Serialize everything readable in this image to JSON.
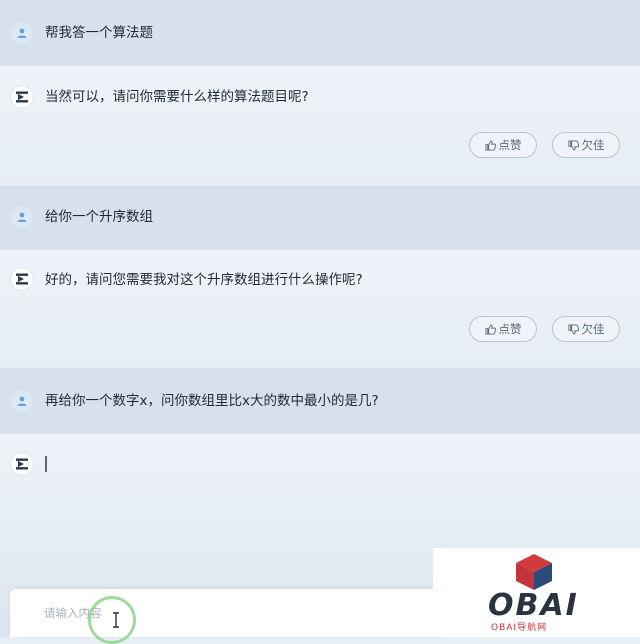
{
  "messages": [
    {
      "role": "user",
      "text": "帮我答一个算法题"
    },
    {
      "role": "bot",
      "text": "当然可以，请问你需要什么样的算法题目呢?"
    },
    {
      "role": "user",
      "text": "给你一个升序数组"
    },
    {
      "role": "bot",
      "text": "好的，请问您需要我对这个升序数组进行什么操作呢?"
    },
    {
      "role": "user",
      "text": "再给你一个数字x，问你数组里比x大的数中最小的是几?"
    }
  ],
  "actions": {
    "like_label": "点赞",
    "dislike_label": "欠佳"
  },
  "input": {
    "placeholder": "请输入内容"
  },
  "logo": {
    "text": "OBAI",
    "subtitle": "OBAI导航网"
  },
  "colors": {
    "user_row": "#d6e1ec",
    "bot_row": "#eef3f8",
    "avatar_user": "#6f9fd0",
    "logo_red": "#c4343c",
    "logo_blue": "#2c4a7a"
  }
}
